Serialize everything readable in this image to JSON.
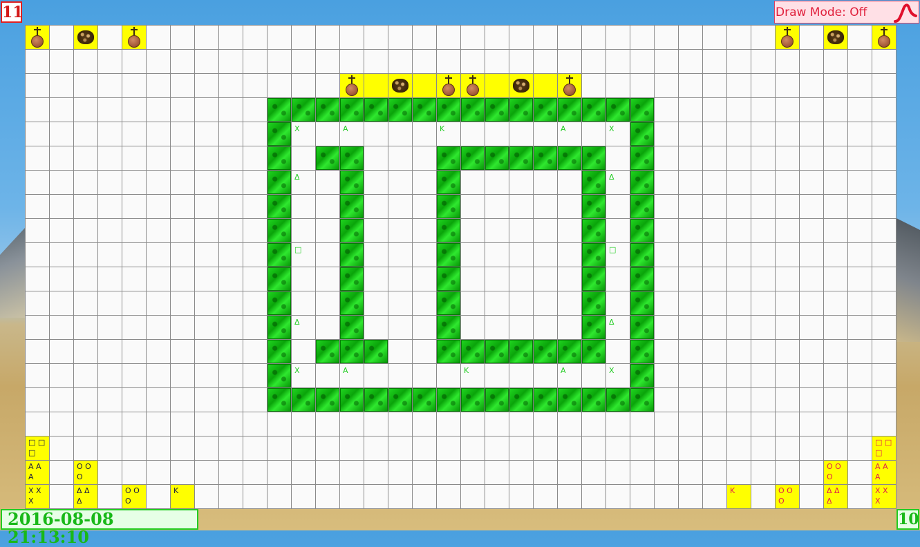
{
  "header": {
    "level": "11",
    "draw_mode_label": "Draw Mode: Off",
    "draw_mode_icon": "pen-curve-icon",
    "accent_color": "#e0203c"
  },
  "footer": {
    "datetime": "2016-08-08 21:13:10",
    "score": "10",
    "color": "#18b818"
  },
  "board": {
    "columns": 36,
    "rows": 20,
    "walls": [
      [
        10,
        3
      ],
      [
        11,
        3
      ],
      [
        12,
        3
      ],
      [
        13,
        3
      ],
      [
        14,
        3
      ],
      [
        15,
        3
      ],
      [
        16,
        3
      ],
      [
        17,
        3
      ],
      [
        18,
        3
      ],
      [
        19,
        3
      ],
      [
        20,
        3
      ],
      [
        21,
        3
      ],
      [
        22,
        3
      ],
      [
        23,
        3
      ],
      [
        24,
        3
      ],
      [
        25,
        3
      ],
      [
        10,
        4
      ],
      [
        25,
        4
      ],
      [
        10,
        5
      ],
      [
        12,
        5
      ],
      [
        13,
        5
      ],
      [
        17,
        5
      ],
      [
        18,
        5
      ],
      [
        19,
        5
      ],
      [
        20,
        5
      ],
      [
        21,
        5
      ],
      [
        22,
        5
      ],
      [
        23,
        5
      ],
      [
        25,
        5
      ],
      [
        10,
        6
      ],
      [
        13,
        6
      ],
      [
        17,
        6
      ],
      [
        23,
        6
      ],
      [
        25,
        6
      ],
      [
        10,
        7
      ],
      [
        13,
        7
      ],
      [
        17,
        7
      ],
      [
        23,
        7
      ],
      [
        25,
        7
      ],
      [
        10,
        8
      ],
      [
        13,
        8
      ],
      [
        17,
        8
      ],
      [
        23,
        8
      ],
      [
        25,
        8
      ],
      [
        10,
        9
      ],
      [
        13,
        9
      ],
      [
        17,
        9
      ],
      [
        23,
        9
      ],
      [
        25,
        9
      ],
      [
        10,
        10
      ],
      [
        13,
        10
      ],
      [
        17,
        10
      ],
      [
        23,
        10
      ],
      [
        25,
        10
      ],
      [
        10,
        11
      ],
      [
        13,
        11
      ],
      [
        17,
        11
      ],
      [
        23,
        11
      ],
      [
        25,
        11
      ],
      [
        10,
        12
      ],
      [
        13,
        12
      ],
      [
        17,
        12
      ],
      [
        23,
        12
      ],
      [
        25,
        12
      ],
      [
        10,
        13
      ],
      [
        12,
        13
      ],
      [
        13,
        13
      ],
      [
        14,
        13
      ],
      [
        17,
        13
      ],
      [
        18,
        13
      ],
      [
        19,
        13
      ],
      [
        20,
        13
      ],
      [
        21,
        13
      ],
      [
        22,
        13
      ],
      [
        23,
        13
      ],
      [
        25,
        13
      ],
      [
        10,
        14
      ],
      [
        25,
        14
      ],
      [
        10,
        15
      ],
      [
        11,
        15
      ],
      [
        12,
        15
      ],
      [
        13,
        15
      ],
      [
        14,
        15
      ],
      [
        15,
        15
      ],
      [
        16,
        15
      ],
      [
        17,
        15
      ],
      [
        18,
        15
      ],
      [
        19,
        15
      ],
      [
        20,
        15
      ],
      [
        21,
        15
      ],
      [
        22,
        15
      ],
      [
        23,
        15
      ],
      [
        24,
        15
      ],
      [
        25,
        15
      ]
    ],
    "pieces": [
      {
        "col": 0,
        "row": 0,
        "kind": "grave",
        "yellow": true
      },
      {
        "col": 2,
        "row": 0,
        "kind": "bush",
        "yellow": true
      },
      {
        "col": 4,
        "row": 0,
        "kind": "grave",
        "yellow": true
      },
      {
        "col": 31,
        "row": 0,
        "kind": "grave",
        "yellow": true
      },
      {
        "col": 33,
        "row": 0,
        "kind": "bush",
        "yellow": true
      },
      {
        "col": 35,
        "row": 0,
        "kind": "grave",
        "yellow": true
      },
      {
        "col": 13,
        "row": 2,
        "kind": "grave",
        "yellow": true
      },
      {
        "col": 14,
        "row": 2,
        "kind": "empty",
        "yellow": true
      },
      {
        "col": 15,
        "row": 2,
        "kind": "bush",
        "yellow": true
      },
      {
        "col": 16,
        "row": 2,
        "kind": "empty",
        "yellow": true
      },
      {
        "col": 17,
        "row": 2,
        "kind": "grave",
        "yellow": true
      },
      {
        "col": 18,
        "row": 2,
        "kind": "grave",
        "yellow": true
      },
      {
        "col": 19,
        "row": 2,
        "kind": "empty",
        "yellow": true
      },
      {
        "col": 20,
        "row": 2,
        "kind": "bush",
        "yellow": true
      },
      {
        "col": 21,
        "row": 2,
        "kind": "empty",
        "yellow": true
      },
      {
        "col": 22,
        "row": 2,
        "kind": "grave",
        "yellow": true
      }
    ],
    "labels": [
      {
        "col": 11,
        "row": 4,
        "text": "X",
        "color": "green"
      },
      {
        "col": 13,
        "row": 4,
        "text": "A",
        "color": "green"
      },
      {
        "col": 17,
        "row": 4,
        "text": "K",
        "color": "green"
      },
      {
        "col": 22,
        "row": 4,
        "text": "A",
        "color": "green"
      },
      {
        "col": 24,
        "row": 4,
        "text": "X",
        "color": "green"
      },
      {
        "col": 11,
        "row": 6,
        "text": "Δ",
        "color": "green"
      },
      {
        "col": 24,
        "row": 6,
        "text": "Δ",
        "color": "green"
      },
      {
        "col": 11,
        "row": 9,
        "text": "□",
        "color": "green"
      },
      {
        "col": 24,
        "row": 9,
        "text": "□",
        "color": "green"
      },
      {
        "col": 11,
        "row": 12,
        "text": "Δ",
        "color": "green"
      },
      {
        "col": 24,
        "row": 12,
        "text": "Δ",
        "color": "green"
      },
      {
        "col": 11,
        "row": 14,
        "text": "X",
        "color": "green"
      },
      {
        "col": 13,
        "row": 14,
        "text": "A",
        "color": "green"
      },
      {
        "col": 18,
        "row": 14,
        "text": "K",
        "color": "green"
      },
      {
        "col": 22,
        "row": 14,
        "text": "A",
        "color": "green"
      },
      {
        "col": 24,
        "row": 14,
        "text": "X",
        "color": "green"
      }
    ],
    "player_tiles": [
      {
        "col": 0,
        "row": 17,
        "lines": [
          "□ □",
          "□"
        ],
        "color": "dark"
      },
      {
        "col": 0,
        "row": 18,
        "lines": [
          "A A",
          "A"
        ],
        "color": "dark"
      },
      {
        "col": 0,
        "row": 19,
        "lines": [
          "X X",
          "X"
        ],
        "color": "dark"
      },
      {
        "col": 2,
        "row": 18,
        "lines": [
          "O O",
          "O"
        ],
        "color": "dark"
      },
      {
        "col": 2,
        "row": 19,
        "lines": [
          "Δ Δ",
          "Δ"
        ],
        "color": "dark"
      },
      {
        "col": 4,
        "row": 19,
        "lines": [
          "O O",
          "O"
        ],
        "color": "dark"
      },
      {
        "col": 6,
        "row": 19,
        "lines": [
          "K"
        ],
        "color": "dark"
      },
      {
        "col": 29,
        "row": 19,
        "lines": [
          "K"
        ],
        "color": "red"
      },
      {
        "col": 31,
        "row": 19,
        "lines": [
          "O O",
          "O"
        ],
        "color": "red"
      },
      {
        "col": 33,
        "row": 18,
        "lines": [
          "O O",
          "O"
        ],
        "color": "red"
      },
      {
        "col": 33,
        "row": 19,
        "lines": [
          "Δ Δ",
          "Δ"
        ],
        "color": "red"
      },
      {
        "col": 35,
        "row": 17,
        "lines": [
          "□ □",
          "□"
        ],
        "color": "red"
      },
      {
        "col": 35,
        "row": 18,
        "lines": [
          "A A",
          "A"
        ],
        "color": "red"
      },
      {
        "col": 35,
        "row": 19,
        "lines": [
          "X X",
          "X"
        ],
        "color": "red"
      }
    ]
  }
}
